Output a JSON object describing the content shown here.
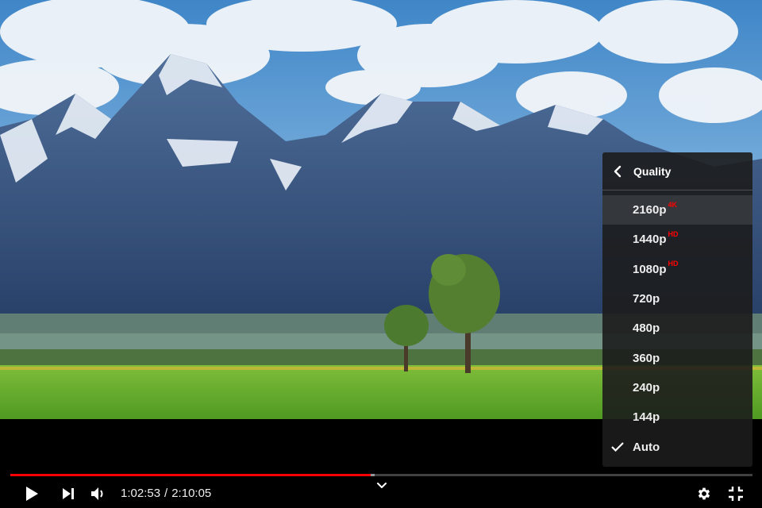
{
  "player": {
    "current_time": "1:02:53",
    "time_separator": "/",
    "duration": "2:10:05",
    "progress_fraction": 0.486,
    "buffered_fraction": 0.491
  },
  "colors": {
    "progress_played": "#ff0000",
    "quality_badge": "#ff0000",
    "menu_background": "#1c1c1c"
  },
  "icons": {
    "play": "play-icon",
    "next": "next-icon",
    "volume": "volume-icon",
    "chapter": "chevron-down-icon",
    "settings": "gear-icon",
    "exit_fullscreen": "exit-fullscreen-icon",
    "back": "chevron-left-icon",
    "selected": "checkmark-icon"
  },
  "quality_menu": {
    "title": "Quality",
    "items": [
      {
        "label": "2160p",
        "badge": "4K",
        "highlighted": true,
        "selected": false
      },
      {
        "label": "1440p",
        "badge": "HD",
        "highlighted": false,
        "selected": false
      },
      {
        "label": "1080p",
        "badge": "HD",
        "highlighted": false,
        "selected": false
      },
      {
        "label": "720p",
        "badge": "",
        "highlighted": false,
        "selected": false
      },
      {
        "label": "480p",
        "badge": "",
        "highlighted": false,
        "selected": false
      },
      {
        "label": "360p",
        "badge": "",
        "highlighted": false,
        "selected": false
      },
      {
        "label": "240p",
        "badge": "",
        "highlighted": false,
        "selected": false
      },
      {
        "label": "144p",
        "badge": "",
        "highlighted": false,
        "selected": false
      },
      {
        "label": "Auto",
        "badge": "",
        "highlighted": false,
        "selected": true
      }
    ]
  }
}
